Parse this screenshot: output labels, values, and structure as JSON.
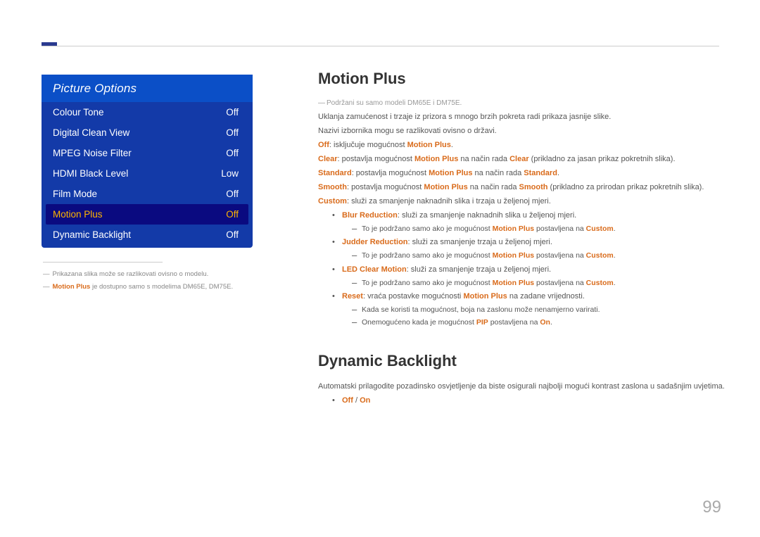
{
  "pagenum": "99",
  "sidebar": {
    "title": "Picture Options",
    "items": [
      {
        "label": "Colour Tone",
        "value": "Off",
        "selected": false
      },
      {
        "label": "Digital Clean View",
        "value": "Off",
        "selected": false
      },
      {
        "label": "MPEG Noise Filter",
        "value": "Off",
        "selected": false
      },
      {
        "label": "HDMI Black Level",
        "value": "Low",
        "selected": false
      },
      {
        "label": "Film Mode",
        "value": "Off",
        "selected": false
      },
      {
        "label": "Motion Plus",
        "value": "Off",
        "selected": true
      },
      {
        "label": "Dynamic Backlight",
        "value": "Off",
        "selected": false
      }
    ],
    "foot1": "Prikazana slika može se razlikovati ovisno o modelu.",
    "foot2_hl": "Motion Plus",
    "foot2_rest": " je dostupno samo s modelima DM65E, DM75E."
  },
  "section1": {
    "heading": "Motion Plus",
    "note": "Podržani su samo modeli DM65E i DM75E.",
    "p1": "Uklanja zamućenost i trzaje iz prizora s mnogo brzih pokreta radi prikaza jasnije slike.",
    "p2": "Nazivi izbornika mogu se razlikovati ovisno o državi.",
    "off_hl": "Off",
    "off_mid": ": isključuje mogućnost ",
    "off_hl2": "Motion Plus",
    "off_end": ".",
    "clear_hl": "Clear",
    "clear_mid1": ": postavlja mogućnost ",
    "clear_hl2": "Motion Plus",
    "clear_mid2": " na način rada ",
    "clear_hl3": "Clear",
    "clear_end": " (prikladno za jasan prikaz pokretnih slika).",
    "std_hl": "Standard",
    "std_mid1": ": postavlja mogućnost ",
    "std_hl2": "Motion Plus",
    "std_mid2": " na način rada ",
    "std_hl3": "Standard",
    "std_end": ".",
    "smooth_hl": "Smooth",
    "smooth_mid1": ": postavlja mogućnost ",
    "smooth_hl2": "Motion Plus",
    "smooth_mid2": " na način rada ",
    "smooth_hl3": "Smooth",
    "smooth_end": " (prikladno za prirodan prikaz pokretnih slika).",
    "custom_hl": "Custom",
    "custom_end": ": služi za smanjenje naknadnih slika i trzaja u željenoj mjeri.",
    "bullets": {
      "blur_hl": "Blur Reduction",
      "blur_end": ": služi za smanjenje naknadnih slika u željenoj mjeri.",
      "blur_sub_a": "To je podržano samo ako je mogućnost ",
      "blur_sub_hl": "Motion Plus",
      "blur_sub_b": " postavljena na ",
      "blur_sub_hl2": "Custom",
      "blur_sub_end": ".",
      "judder_hl": "Judder Reduction",
      "judder_end": ": služi za smanjenje trzaja u željenoj mjeri.",
      "judder_sub_a": "To je podržano samo ako je mogućnost ",
      "judder_sub_hl": "Motion Plus",
      "judder_sub_b": " postavljena na ",
      "judder_sub_hl2": "Custom",
      "judder_sub_end": ".",
      "led_hl": "LED Clear Motion",
      "led_end": ": služi za smanjenje trzaja u željenoj mjeri.",
      "led_sub_a": "To je podržano samo ako je mogućnost ",
      "led_sub_hl": "Motion Plus",
      "led_sub_b": " postavljena na ",
      "led_sub_hl2": "Custom",
      "led_sub_end": ".",
      "reset_hl": "Reset",
      "reset_mid": ": vraća postavke mogućnosti ",
      "reset_hl2": "Motion Plus",
      "reset_end": " na zadane vrijednosti.",
      "reset_sub1": "Kada se koristi ta mogućnost, boja na zaslonu može nenamjerno varirati.",
      "reset_sub2_a": "Onemogućeno kada je mogućnost ",
      "reset_sub2_hl": "PIP",
      "reset_sub2_b": " postavljena na ",
      "reset_sub2_hl2": "On",
      "reset_sub2_end": "."
    }
  },
  "section2": {
    "heading": "Dynamic Backlight",
    "p1": "Automatski prilagodite pozadinsko osvjetljenje da biste osigurali najbolji mogući kontrast zaslona u sadašnjim uvjetima.",
    "bullet_hl1": "Off",
    "bullet_sep": " / ",
    "bullet_hl2": "On"
  }
}
